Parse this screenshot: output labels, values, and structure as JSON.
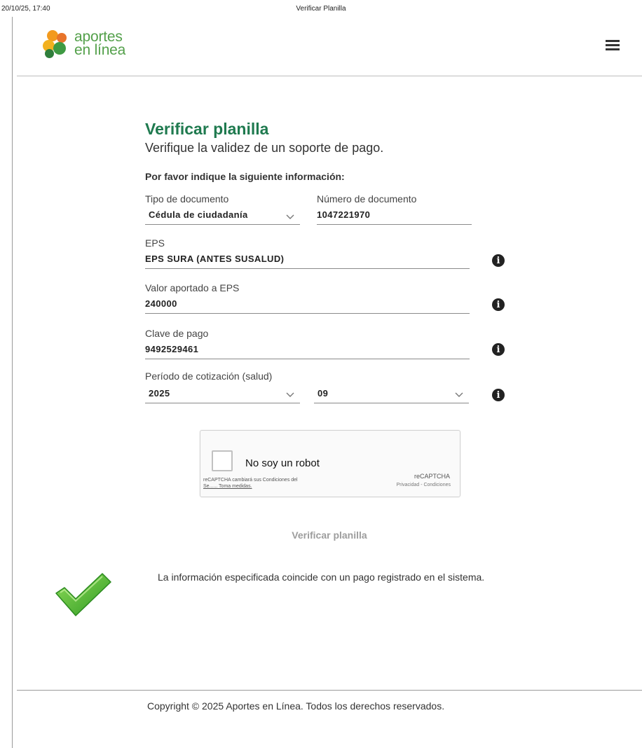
{
  "print_header": {
    "date": "20/10/25, 17:40",
    "title": "Verificar Planilla"
  },
  "brand": {
    "line1": "aportes",
    "line2": "en línea"
  },
  "menu": {
    "icon": "hamburger-icon"
  },
  "form": {
    "title": "Verificar planilla",
    "subtitle": "Verifique la validez de un soporte de pago.",
    "instruction": "Por favor indique la siguiente información:",
    "tipo_documento": {
      "label": "Tipo de documento",
      "value": "Cédula de ciudadanía"
    },
    "numero_documento": {
      "label": "Número de documento",
      "value": "1047221970"
    },
    "eps": {
      "label": "EPS",
      "value": "EPS SURA (ANTES SUSALUD)"
    },
    "valor_eps": {
      "label": "Valor aportado a EPS",
      "value": "240000"
    },
    "clave_pago": {
      "label": "Clave de pago",
      "value": "9492529461"
    },
    "periodo": {
      "label": "Período de cotización (salud)",
      "year": "2025",
      "month": "09"
    },
    "info_icon": "i"
  },
  "captcha": {
    "label": "No soy un robot",
    "note_line1": "reCAPTCHA cambiará sus Condiciones del",
    "note_line2": "Se...... Toma medidas.",
    "brand": "reCAPTCHA",
    "terms": "Privacidad - Condiciones"
  },
  "verify_button": "Verificar planilla",
  "result": {
    "message": "La información especificada coincide con un pago registrado en el sistema.",
    "icon": "checkmark-icon"
  },
  "footer": {
    "copyright": "Copyright © 2025 Aportes en Línea. Todos los derechos reservados."
  },
  "colors": {
    "title_green": "#1f7a4f",
    "logo_green": "#53a04a",
    "logo_orange": "#f39a1e",
    "check_green": "#3aa22c"
  }
}
